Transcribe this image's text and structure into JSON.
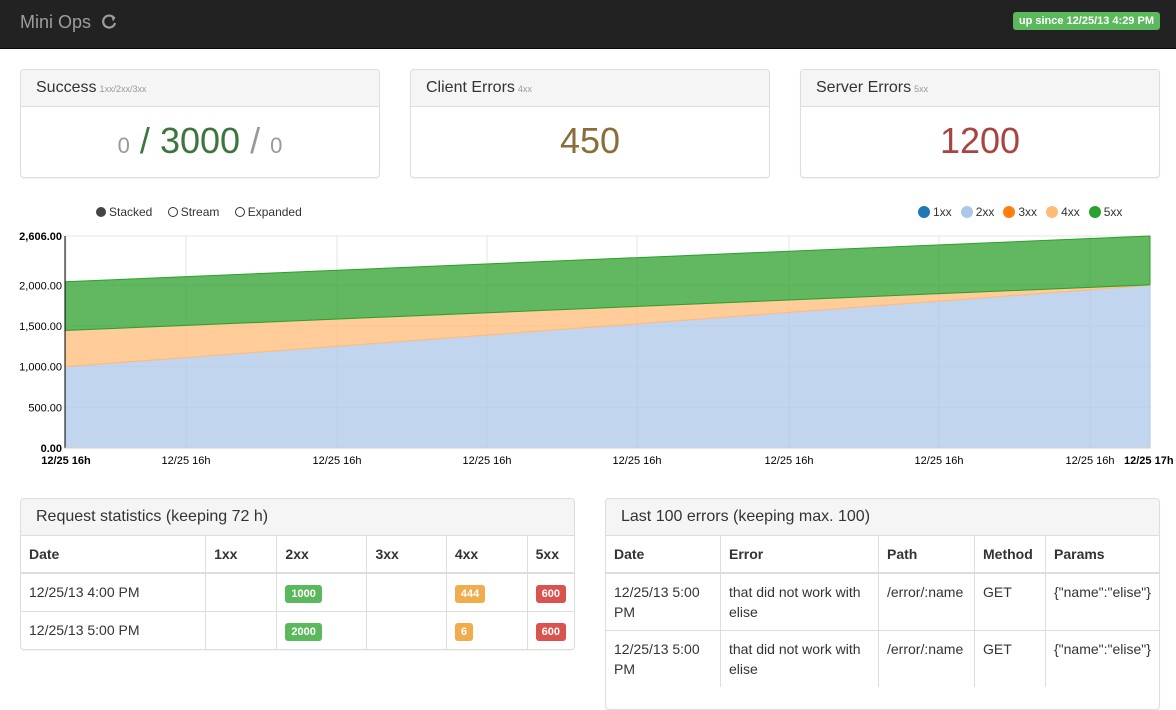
{
  "navbar": {
    "brand": "Mini Ops",
    "uptime": "up since 12/25/13 4:29 PM"
  },
  "stats": {
    "success": {
      "title": "Success",
      "subtitle": "1xx/2xx/3xx",
      "v1": "0",
      "v2": "3000",
      "v3": "0",
      "sep": "/"
    },
    "client": {
      "title": "Client Errors",
      "subtitle": "4xx",
      "value": "450"
    },
    "server": {
      "title": "Server Errors",
      "subtitle": "5xx",
      "value": "1200"
    }
  },
  "chart_controls": {
    "stacked": "Stacked",
    "stream": "Stream",
    "expanded": "Expanded",
    "selected": "Stacked"
  },
  "chart_data": {
    "type": "area",
    "stacked": true,
    "legend_position": "top-right",
    "grid": true,
    "series": [
      {
        "name": "1xx",
        "color": "#1f77b4",
        "values": [
          0,
          0
        ]
      },
      {
        "name": "2xx",
        "color": "#aec7e8",
        "values": [
          1000,
          2000
        ]
      },
      {
        "name": "3xx",
        "color": "#ff7f0e",
        "values": [
          0,
          0
        ]
      },
      {
        "name": "4xx",
        "color": "#ffbb78",
        "values": [
          444,
          6
        ]
      },
      {
        "name": "5xx",
        "color": "#2ca02c",
        "values": [
          600,
          600
        ]
      }
    ],
    "x": [
      "12/25/13 4:00 PM",
      "12/25/13 5:00 PM"
    ],
    "ylim": [
      0,
      2606
    ],
    "y_max_label": "2,606.00",
    "y_ticks": [
      "0.00",
      "500.00",
      "1,000.00",
      "1,500.00",
      "2,000.00"
    ],
    "x_ticks": [
      "12/25 16h",
      "12/25 16h",
      "12/25 16h",
      "12/25 16h",
      "12/25 16h",
      "12/25 16h",
      "12/25 16h",
      "12/25 16h",
      "12/25 17h"
    ]
  },
  "requests": {
    "title": "Request statistics (keeping 72 h)",
    "headers": [
      "Date",
      "1xx",
      "2xx",
      "3xx",
      "4xx",
      "5xx"
    ],
    "rows": [
      {
        "date": "12/25/13 4:00 PM",
        "c1": "",
        "c2": "1000",
        "c3": "",
        "c4": "444",
        "c5": "600"
      },
      {
        "date": "12/25/13 5:00 PM",
        "c1": "",
        "c2": "2000",
        "c3": "",
        "c4": "6",
        "c5": "600"
      }
    ]
  },
  "errors": {
    "title": "Last 100 errors (keeping max. 100)",
    "headers": [
      "Date",
      "Error",
      "Path",
      "Method",
      "Params"
    ],
    "rows": [
      {
        "date": "12/25/13 5:00 PM",
        "error": "that did not work with elise",
        "path": "/error/:name",
        "method": "GET",
        "params": "{\"name\":\"elise\"}"
      },
      {
        "date": "12/25/13 5:00 PM",
        "error": "that did not work with elise",
        "path": "/error/:name",
        "method": "GET",
        "params": "{\"name\":\"elise\"}"
      }
    ]
  }
}
